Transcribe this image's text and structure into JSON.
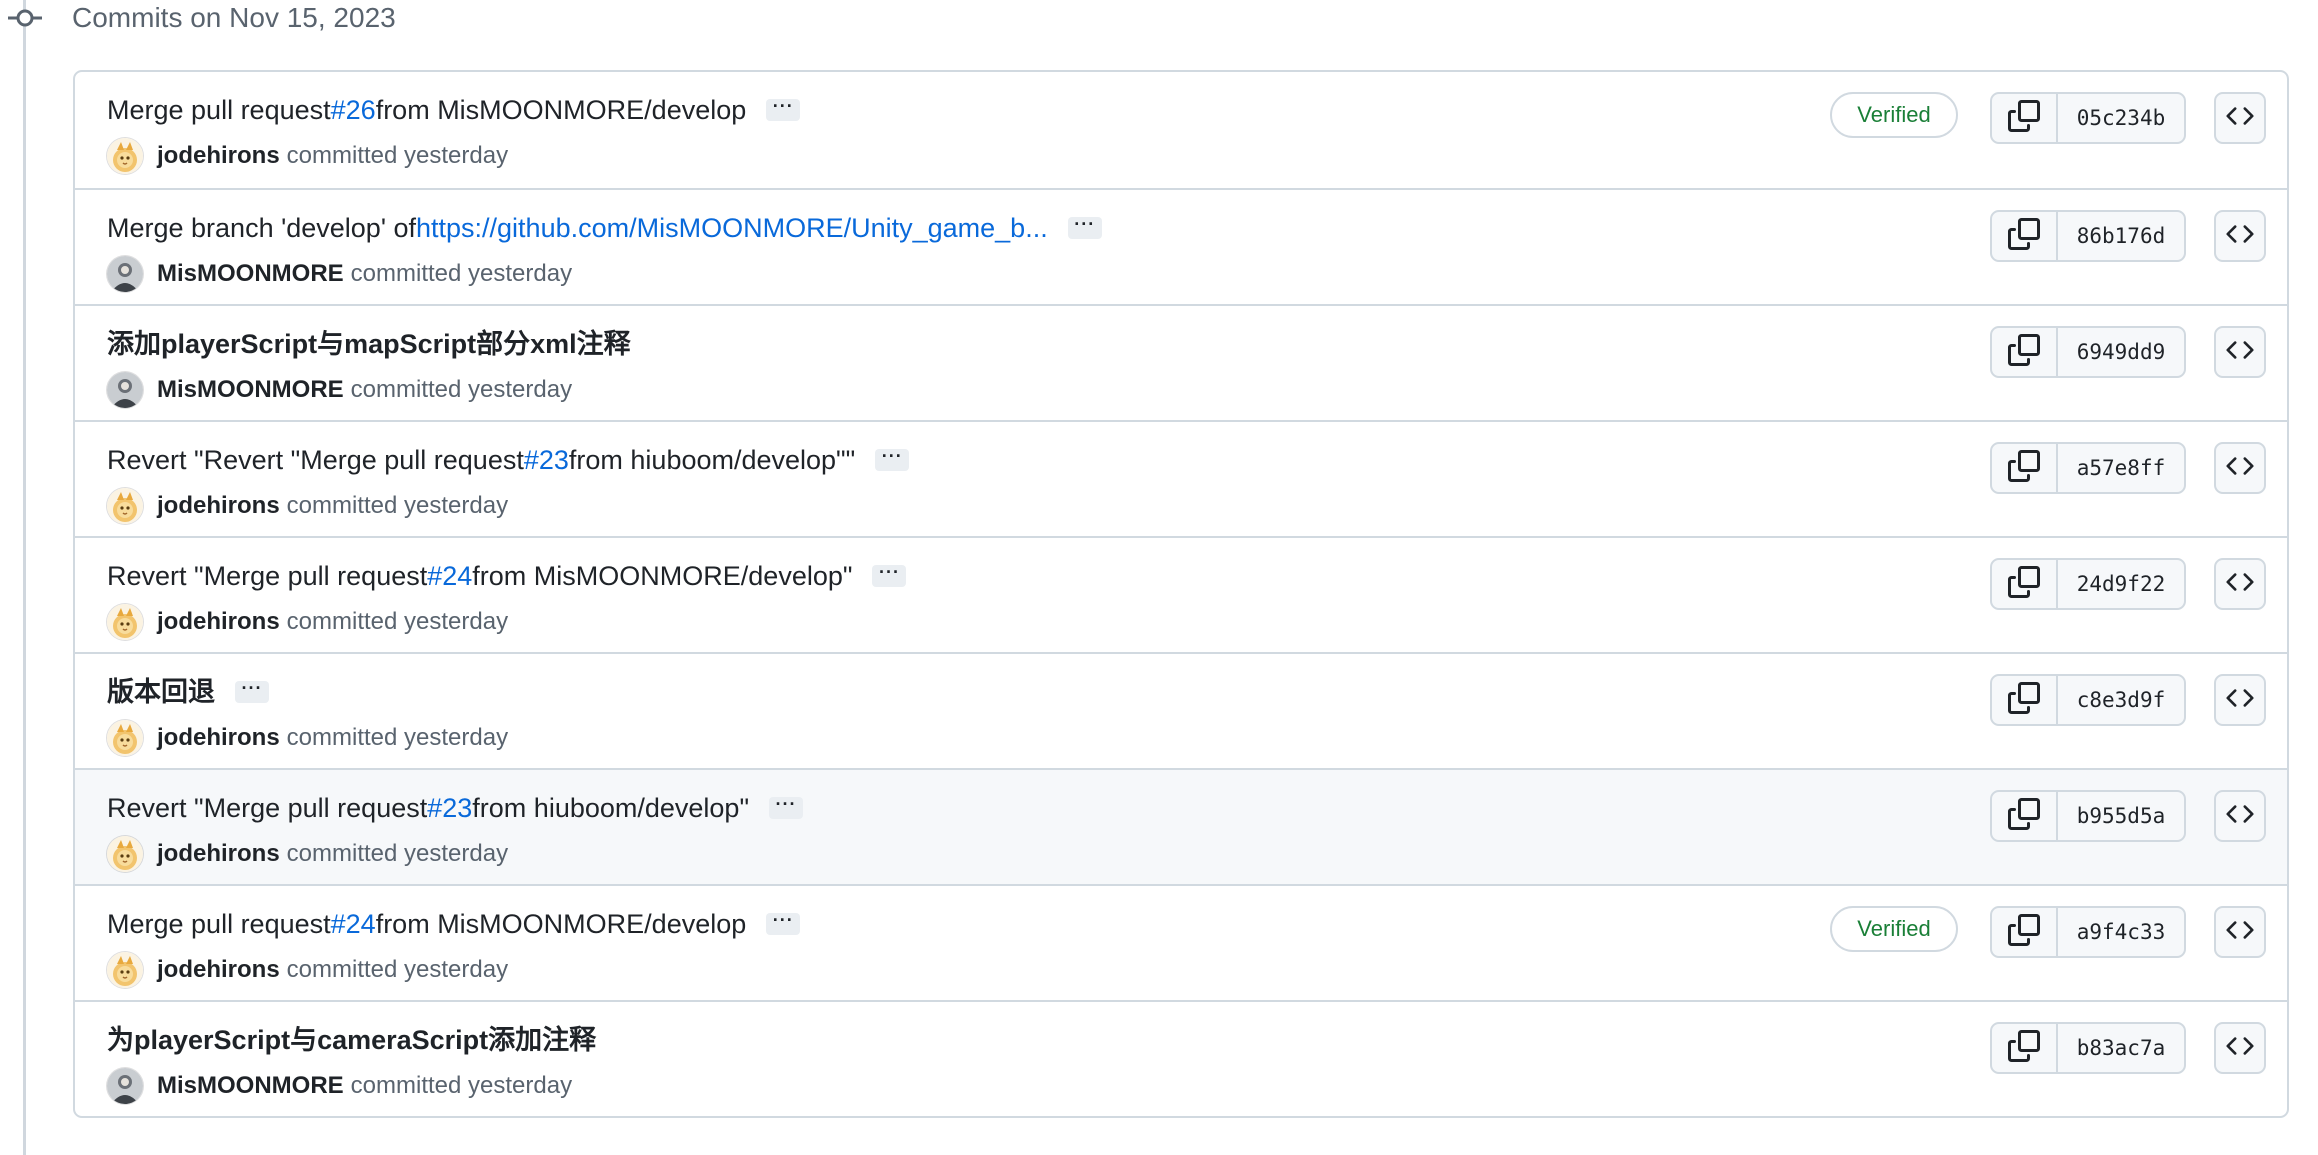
{
  "day_header": "Commits on Nov 15, 2023",
  "ellipsis_label": "···",
  "colors": {
    "link": "#0969da",
    "verified": "#1a7f37",
    "border": "#d1d9e0",
    "muted": "#59636e"
  },
  "commits": [
    {
      "title_parts": [
        "Merge pull request ",
        "#26",
        " from MisMOONMORE/develop"
      ],
      "author": "jodehirons",
      "avatar": "cat-avatar",
      "committed": "committed yesterday",
      "verified": "Verified",
      "sha": "05c234b"
    },
    {
      "title_parts": [
        "Merge branch 'develop' of ",
        "https://github.com/MisMOONMORE/Unity_game_b...",
        ""
      ],
      "author": "MisMOONMORE",
      "avatar": "person-avatar",
      "committed": "committed yesterday",
      "verified": "",
      "sha": "86b176d"
    },
    {
      "title_parts": [
        "添加playerScript与mapScript部分xml注释",
        "",
        ""
      ],
      "author": "MisMOONMORE",
      "avatar": "person-avatar",
      "committed": "committed yesterday",
      "verified": "",
      "sha": "6949dd9"
    },
    {
      "title_parts": [
        "Revert \"Revert \"Merge pull request ",
        "#23",
        " from hiuboom/develop\"\""
      ],
      "author": "jodehirons",
      "avatar": "cat-avatar",
      "committed": "committed yesterday",
      "verified": "",
      "sha": "a57e8ff"
    },
    {
      "title_parts": [
        "Revert \"Merge pull request ",
        "#24",
        " from MisMOONMORE/develop\""
      ],
      "author": "jodehirons",
      "avatar": "cat-avatar",
      "committed": "committed yesterday",
      "verified": "",
      "sha": "24d9f22"
    },
    {
      "title_parts": [
        "版本回退",
        "",
        ""
      ],
      "author": "jodehirons",
      "avatar": "cat-avatar",
      "committed": "committed yesterday",
      "verified": "",
      "sha": "c8e3d9f"
    },
    {
      "title_parts": [
        "Revert \"Merge pull request ",
        "#23",
        " from hiuboom/develop\""
      ],
      "author": "jodehirons",
      "avatar": "cat-avatar",
      "committed": "committed yesterday",
      "verified": "",
      "sha": "b955d5a"
    },
    {
      "title_parts": [
        "Merge pull request ",
        "#24",
        " from MisMOONMORE/develop"
      ],
      "author": "jodehirons",
      "avatar": "cat-avatar",
      "committed": "committed yesterday",
      "verified": "Verified",
      "sha": "a9f4c33"
    },
    {
      "title_parts": [
        "为playerScript与cameraScript添加注释",
        "",
        ""
      ],
      "author": "MisMOONMORE",
      "avatar": "person-avatar",
      "committed": "committed yesterday",
      "verified": "",
      "sha": "b83ac7a"
    }
  ]
}
